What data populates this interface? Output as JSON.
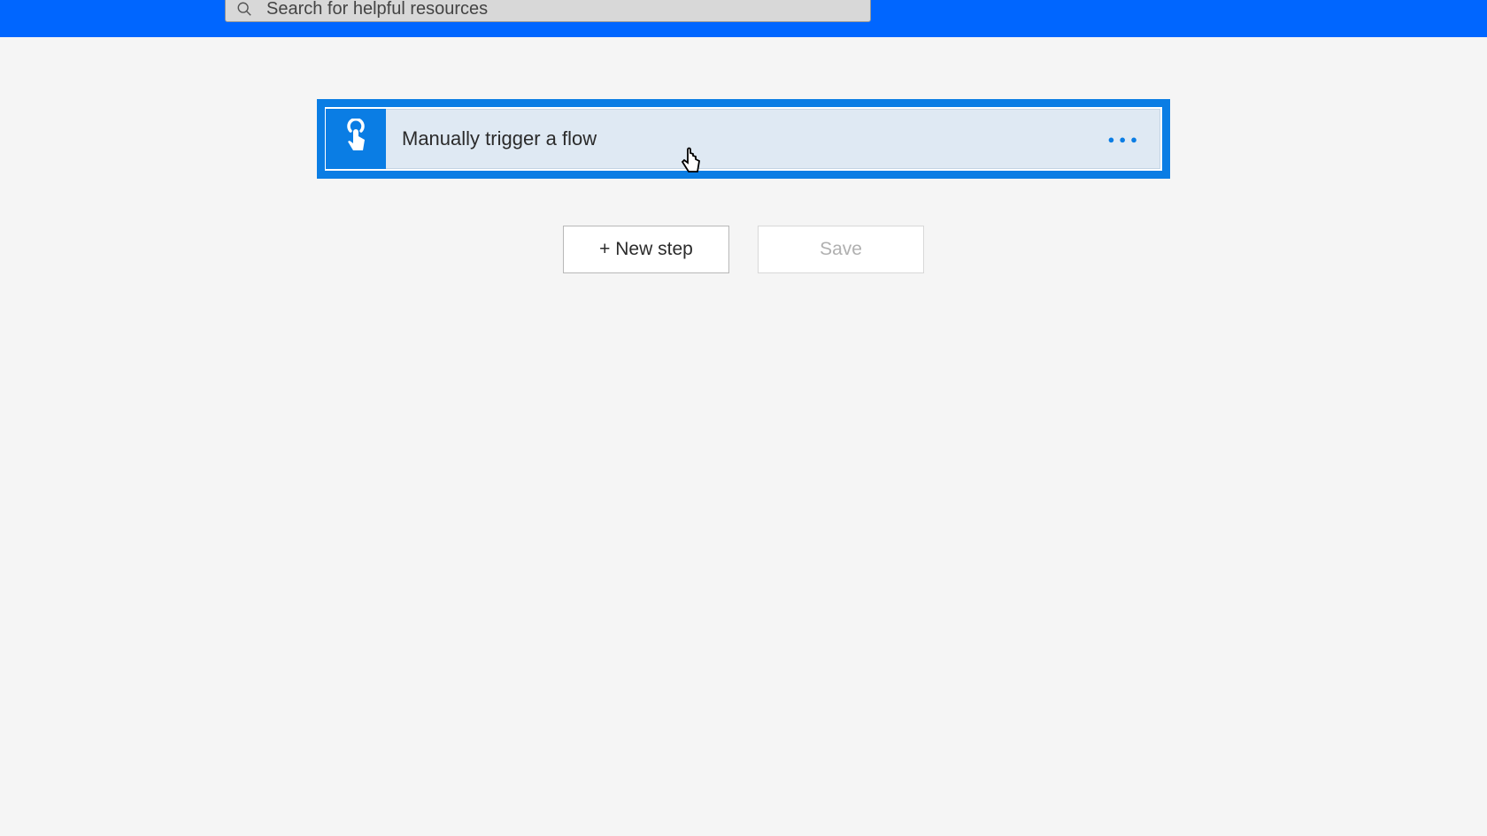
{
  "header": {
    "search_placeholder": "Search for helpful resources"
  },
  "trigger": {
    "title": "Manually trigger a flow",
    "icon_name": "touch-tap-icon"
  },
  "buttons": {
    "new_step_label": "+ New step",
    "save_label": "Save"
  }
}
